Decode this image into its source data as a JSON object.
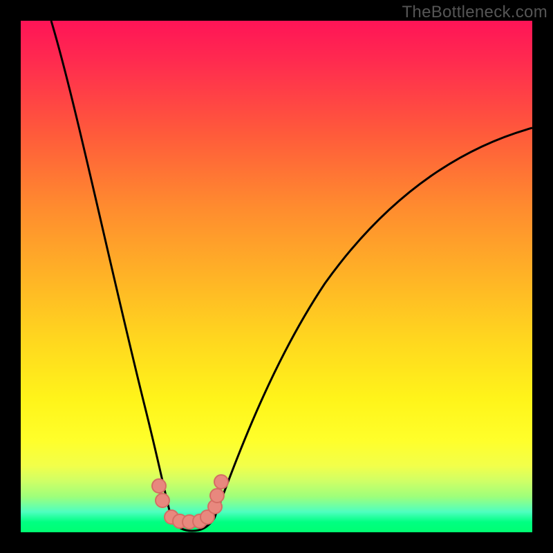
{
  "watermark": "TheBottleneck.com",
  "colors": {
    "frame": "#000000",
    "curve_stroke": "#000000",
    "marker_fill": "#e8887e",
    "marker_stroke": "#d46d64",
    "gradient_stops": [
      "#ff1457",
      "#ff2b4f",
      "#ff5a3b",
      "#ff8a2f",
      "#ffb326",
      "#ffd61f",
      "#fff41a",
      "#ffff2a",
      "#f2ff4a",
      "#cfff66",
      "#9fff7a",
      "#4fffc0",
      "#00ff82",
      "#00ff72"
    ]
  },
  "chart_data": {
    "type": "line",
    "title": "",
    "xlabel": "",
    "ylabel": "",
    "xlim": [
      0,
      100
    ],
    "ylim": [
      0,
      100
    ],
    "note": "Axes have no visible tick labels; x/y are normalized 0–100 read from gridless interior.",
    "series": [
      {
        "name": "left-branch",
        "x": [
          6,
          8,
          10,
          12,
          14,
          16,
          18,
          20,
          22,
          24,
          26,
          28,
          29
        ],
        "y": [
          100,
          92,
          84,
          76,
          67,
          58,
          49,
          40,
          31,
          22,
          14,
          6,
          2
        ]
      },
      {
        "name": "valley-floor",
        "x": [
          29,
          30,
          31,
          32,
          33,
          34,
          35,
          36,
          37,
          38
        ],
        "y": [
          2,
          1,
          0.5,
          0.3,
          0.3,
          0.3,
          0.5,
          1,
          2,
          3
        ]
      },
      {
        "name": "right-branch",
        "x": [
          38,
          42,
          46,
          50,
          55,
          60,
          65,
          70,
          75,
          80,
          85,
          90,
          95,
          100
        ],
        "y": [
          3,
          11,
          20,
          28,
          37,
          45,
          52,
          58,
          63,
          67,
          71,
          74,
          77,
          79
        ]
      }
    ],
    "markers": {
      "name": "highlighted-points",
      "shape": "circle",
      "x": [
        27.0,
        27.7,
        29.5,
        31.0,
        33.0,
        35.0,
        36.5,
        38.0,
        38.4,
        39.2
      ],
      "y": [
        9.0,
        6.2,
        3.0,
        2.2,
        2.0,
        2.2,
        3.0,
        5.0,
        7.2,
        9.8
      ]
    }
  }
}
